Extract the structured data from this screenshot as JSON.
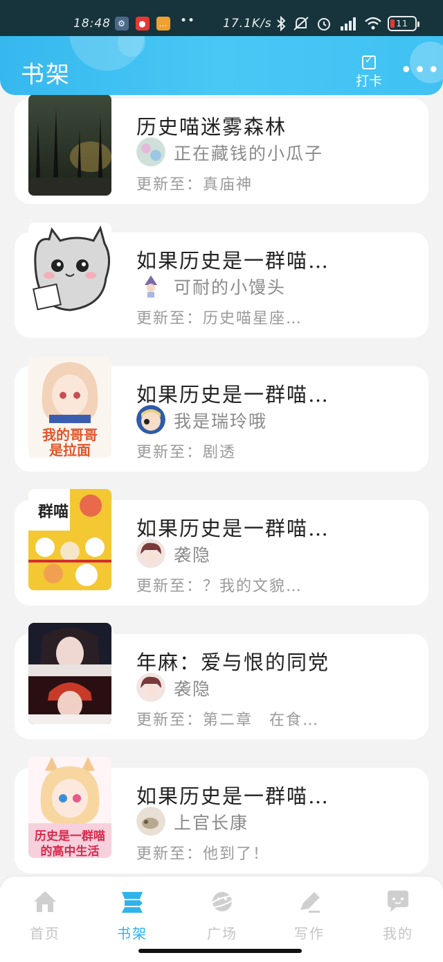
{
  "statusbar": {
    "time": "18:48",
    "dots": "••",
    "net_speed": "17.1K/s",
    "battery": "11"
  },
  "header": {
    "title": "书架",
    "checkin_label": "打卡",
    "more_icon": "more-dots-icon"
  },
  "books": [
    {
      "title": "历史喵迷雾森林",
      "author": "正在藏钱的小瓜子",
      "update": "更新至：真庙神"
    },
    {
      "title": "如果历史是一群喵…",
      "author": "可耐的小馒头",
      "update": "更新至：历史喵星座…"
    },
    {
      "title": "如果历史是一群喵…",
      "author": "我是瑞玲哦",
      "update": "更新至：剧透"
    },
    {
      "title": "如果历史是一群喵…",
      "author": "袭隐",
      "update": "更新至：？我的文貌…"
    },
    {
      "title": "年麻：爱与恨的同党",
      "author": "袭隐",
      "update": "更新至：第二章　在食…"
    },
    {
      "title": "如果历史是一群喵…",
      "author": "上官长康",
      "update": "更新至：他到了！"
    }
  ],
  "nav": {
    "tabs": [
      {
        "label": "首页",
        "icon": "home-icon"
      },
      {
        "label": "书架",
        "icon": "bookshelf-icon"
      },
      {
        "label": "广场",
        "icon": "planet-icon"
      },
      {
        "label": "写作",
        "icon": "pen-icon"
      },
      {
        "label": "我的",
        "icon": "chat-bubble-icon"
      }
    ],
    "active_index": 1
  },
  "colors": {
    "accent": "#30b3ec",
    "header_start": "#36b8ef",
    "header_end": "#3fc1f3",
    "statusbar": "#17343c"
  }
}
